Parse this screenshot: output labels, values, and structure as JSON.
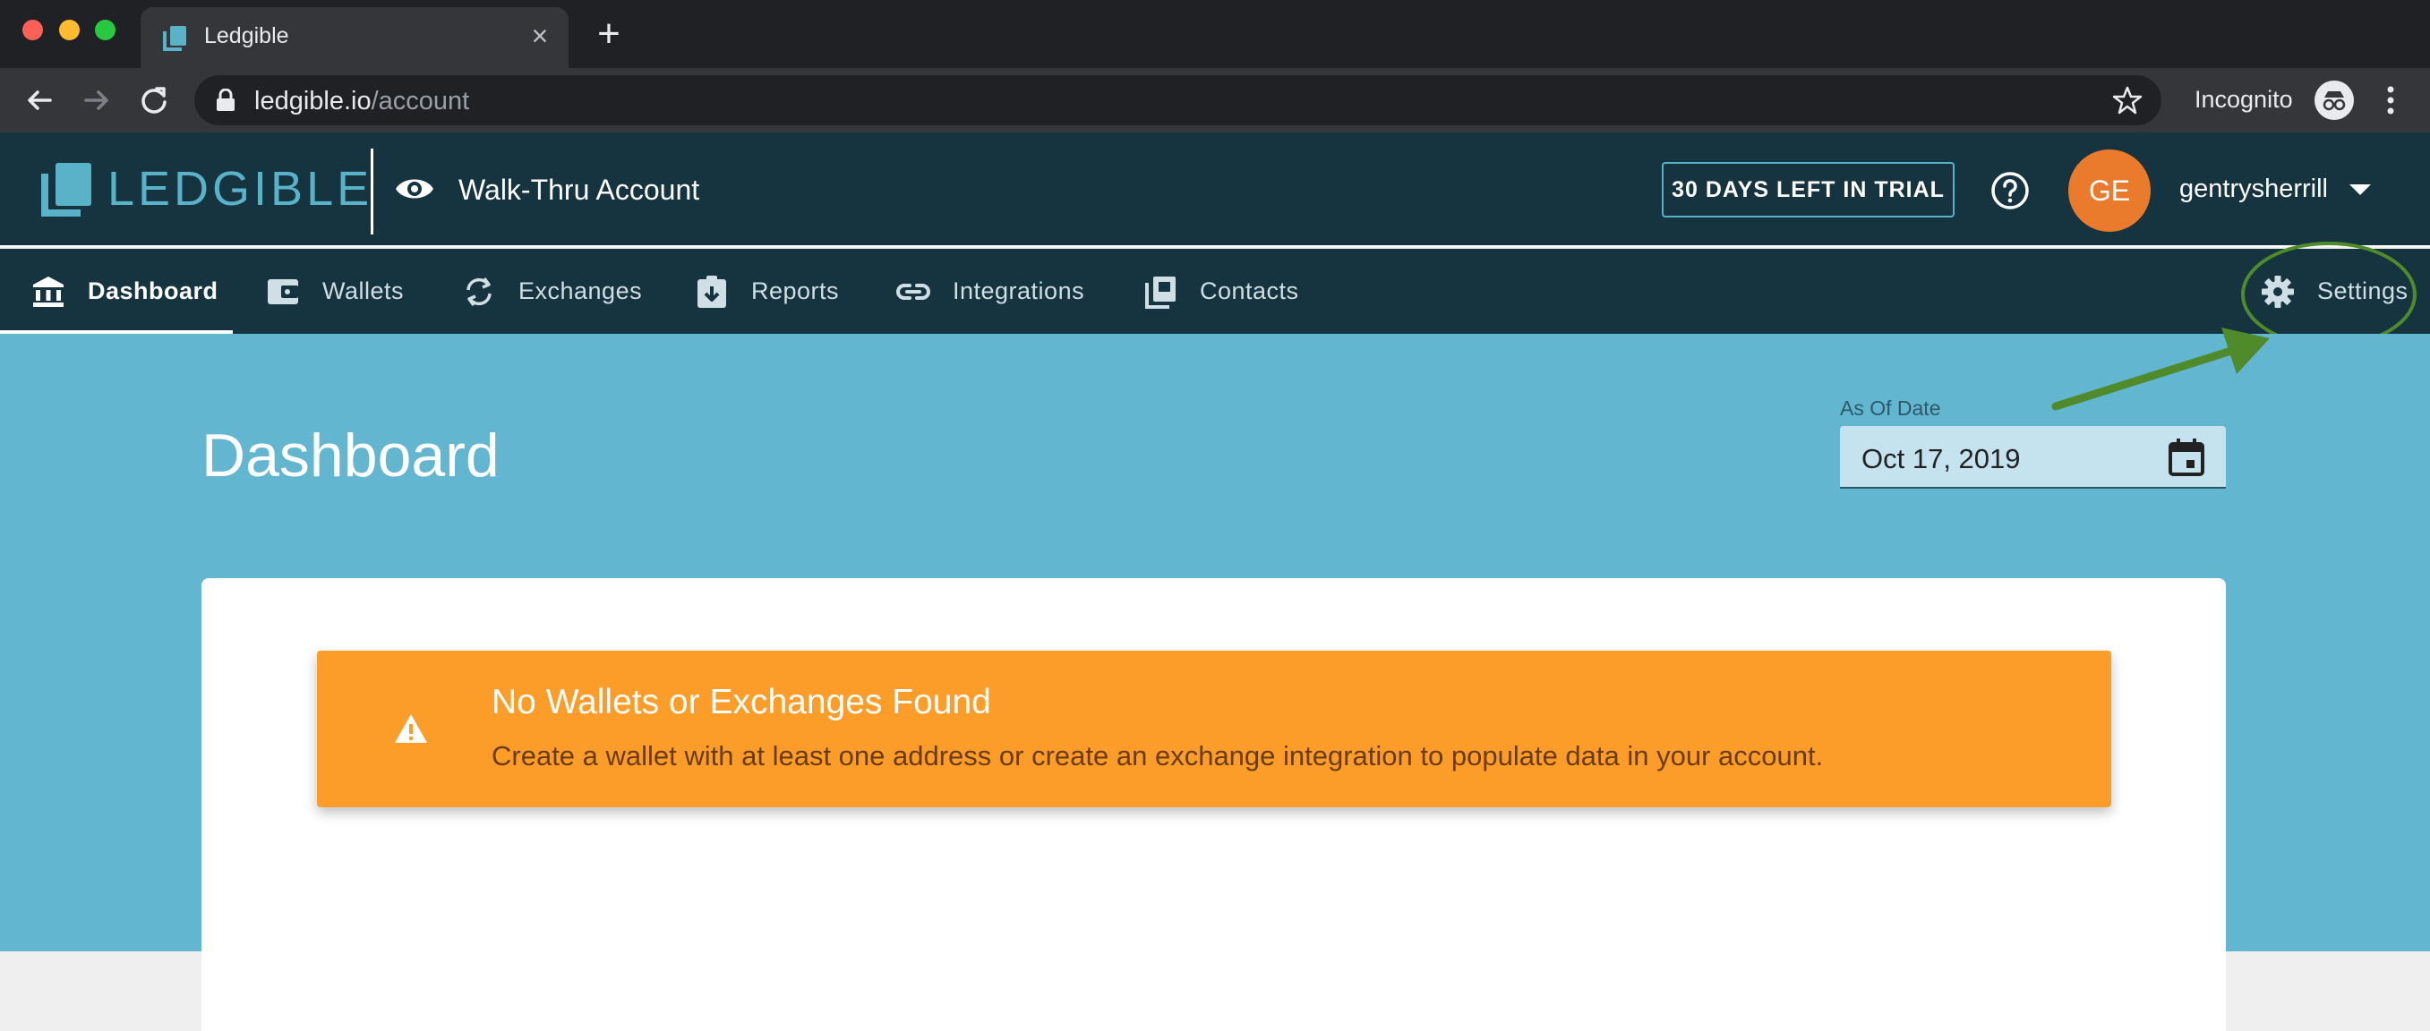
{
  "browser": {
    "tab_title": "Ledgible",
    "url_host": "ledgible.io",
    "url_path": "/account",
    "incognito_label": "Incognito"
  },
  "header": {
    "brand": "LEDGIBLE",
    "account_name": "Walk-Thru Account",
    "trial_badge": "30 DAYS LEFT IN TRIAL",
    "avatar_initials": "GE",
    "username": "gentrysherrill"
  },
  "nav": {
    "items": [
      {
        "label": "Dashboard",
        "icon": "bank-icon",
        "active": true
      },
      {
        "label": "Wallets",
        "icon": "wallet-icon"
      },
      {
        "label": "Exchanges",
        "icon": "sync-icon"
      },
      {
        "label": "Reports",
        "icon": "report-icon"
      },
      {
        "label": "Integrations",
        "icon": "link-icon"
      },
      {
        "label": "Contacts",
        "icon": "contacts-icon"
      }
    ],
    "settings_label": "Settings"
  },
  "main": {
    "page_title": "Dashboard",
    "date_label": "As Of Date",
    "date_value": "Oct 17, 2019",
    "alert": {
      "title": "No Wallets or Exchanges Found",
      "message": "Create a wallet with at least one address or create an exchange integration to populate data in your account."
    }
  },
  "colors": {
    "header_bg": "#163340",
    "hero_bg": "#63b6d0",
    "brand_accent": "#5ab2c8",
    "avatar": "#ea7a2c",
    "alert_bg": "#fd9d29",
    "annotation_green": "#4f8a2b"
  }
}
